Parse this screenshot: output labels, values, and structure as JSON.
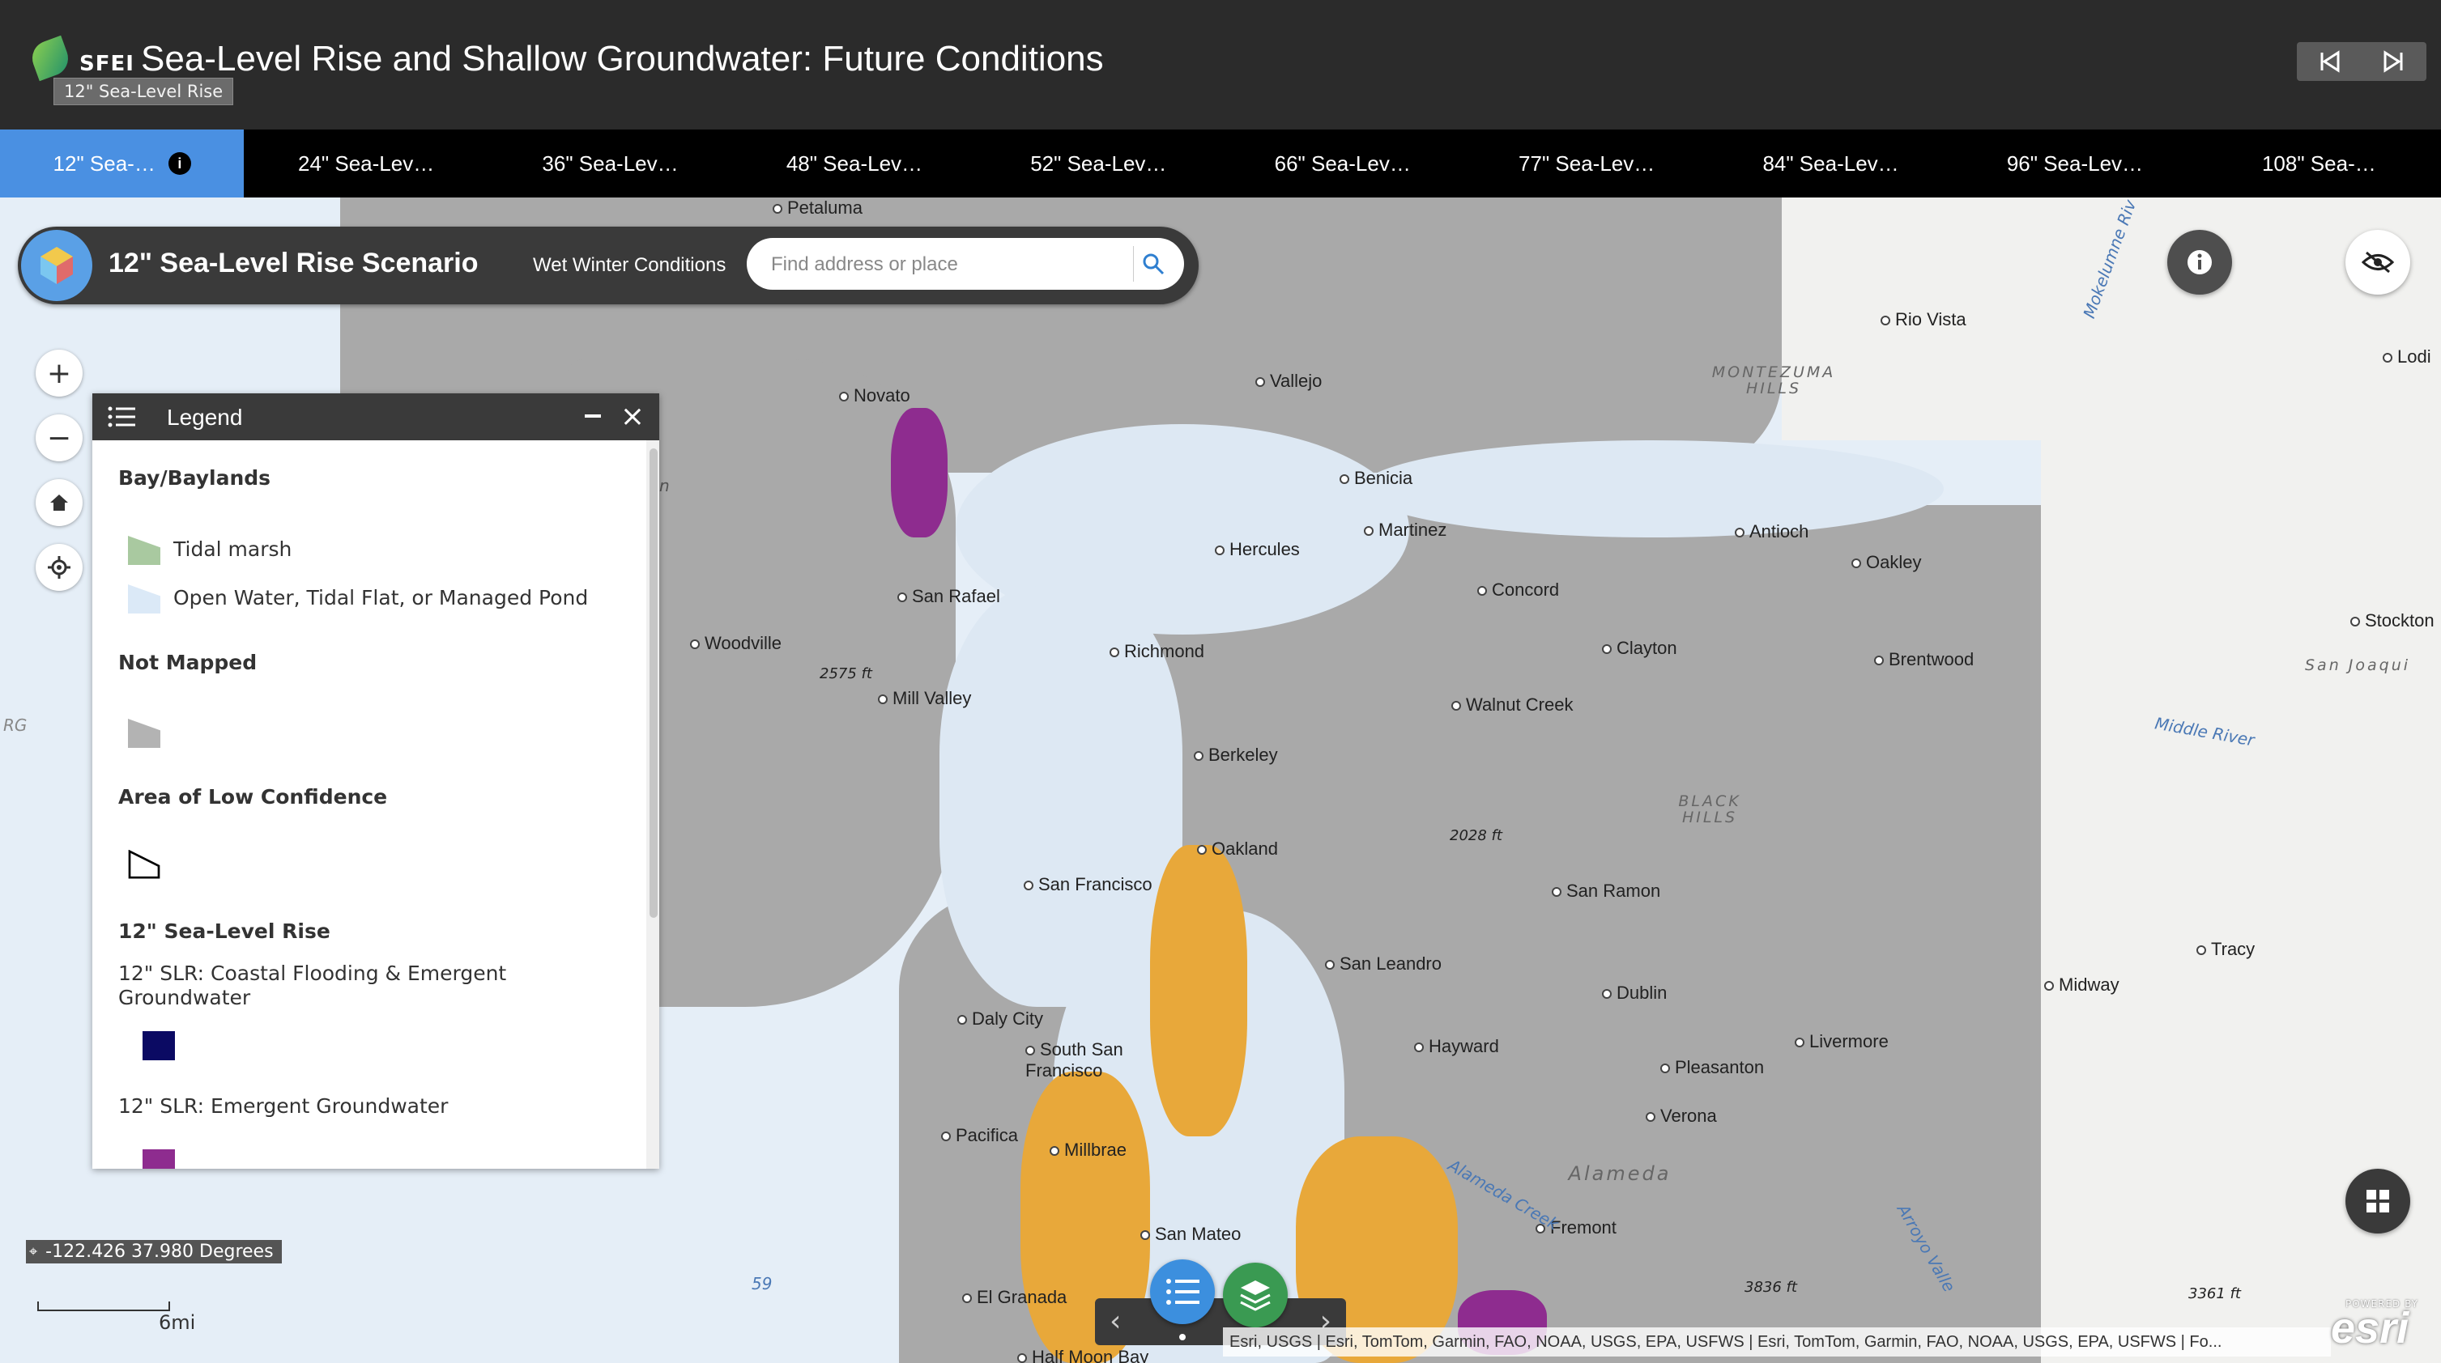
{
  "header": {
    "logo_text": "SFEI",
    "title": "Sea-Level Rise and Shallow Groundwater: Future Conditions",
    "tooltip": "12\" Sea-Level Rise"
  },
  "tabs": [
    {
      "label": "12\" Sea-…"
    },
    {
      "label": "24\" Sea-Lev…"
    },
    {
      "label": "36\" Sea-Lev…"
    },
    {
      "label": "48\" Sea-Lev…"
    },
    {
      "label": "52\" Sea-Lev…"
    },
    {
      "label": "66\" Sea-Lev…"
    },
    {
      "label": "77\" Sea-Lev…"
    },
    {
      "label": "84\" Sea-Lev…"
    },
    {
      "label": "96\" Sea-Lev…"
    },
    {
      "label": "108\" Sea-…"
    }
  ],
  "active_tab": 0,
  "map_title": {
    "title": "12\" Sea-Level Rise Scenario",
    "subtitle": "Wet Winter Conditions",
    "search_placeholder": "Find address or place"
  },
  "legend": {
    "title": "Legend",
    "sections": {
      "baylands": {
        "heading": "Bay/Baylands",
        "items": [
          "Tidal marsh",
          "Open Water, Tidal Flat, or Managed Pond"
        ]
      },
      "not_mapped": {
        "heading": "Not Mapped"
      },
      "low_conf": {
        "heading": "Area of Low Confidence"
      },
      "slr": {
        "heading": "12\" Sea-Level Rise",
        "items": [
          "12\" SLR: Coastal Flooding & Emergent Groundwater",
          "12\" SLR: Emergent Groundwater"
        ]
      }
    }
  },
  "colors": {
    "tidal_marsh": "#a9c9a0",
    "open_water": "#dbe9f7",
    "not_mapped": "#b3b3b3",
    "coastal_flooding": "#0b0a63",
    "emergent_gw": "#8e2c8f",
    "accent": "#4a90e2"
  },
  "map_labels": {
    "cities": [
      "Petaluma",
      "Novato",
      "Vallejo",
      "Benicia",
      "Martinez",
      "Hercules",
      "Rio Vista",
      "Lodi",
      "Antioch",
      "Oakley",
      "Concord",
      "San Rafael",
      "Woodville",
      "Richmond",
      "Clayton",
      "Brentwood",
      "Mill Valley",
      "Walnut Creek",
      "Berkeley",
      "Stockton",
      "Oakland",
      "San Francisco",
      "San Ramon",
      "San Leandro",
      "Dublin",
      "Tracy",
      "Midway",
      "Daly City",
      "South San Francisco",
      "Hayward",
      "Livermore",
      "Pleasanton",
      "Verona",
      "Millbrae",
      "Pacifica",
      "Fremont",
      "San Mateo",
      "El Granada",
      "Half Moon Bay"
    ],
    "features": [
      "MONTEZUMA HILLS",
      "BLACK HILLS",
      "San Joaqui",
      "Middle River",
      "Alameda",
      "Alameda Creek",
      "Arroyo Valle",
      "Mokelumne Riv",
      "RG",
      "59",
      "n"
    ],
    "elevations": [
      "2575 ft",
      "2028 ft",
      "3836 ft",
      "3361 ft"
    ]
  },
  "coordinates": "-122.426 37.980 Degrees",
  "scale": "6mi",
  "attribution": "Esri, USGS | Esri, TomTom, Garmin, FAO, NOAA, USGS, EPA, USFWS | Esri, TomTom, Garmin, FAO, NOAA, USGS, EPA, USFWS | Fo...",
  "esri_logo": "esri",
  "esri_powered": "POWERED BY"
}
